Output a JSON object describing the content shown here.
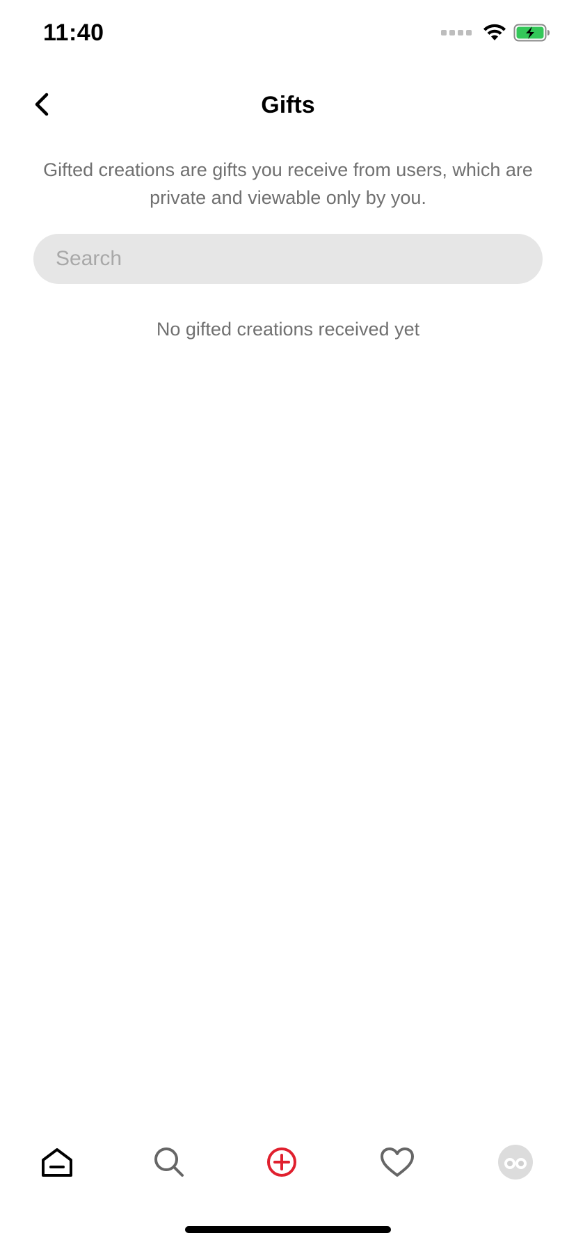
{
  "status_bar": {
    "time": "11:40",
    "icons": [
      "cellular-signal-icon",
      "wifi-icon",
      "battery-charging-icon"
    ],
    "battery_color": "#34c759"
  },
  "nav": {
    "title": "Gifts",
    "back_icon": "chevron-left-icon"
  },
  "description": "Gifted creations are gifts you receive from users, which are private and viewable only by you.",
  "search": {
    "placeholder": "Search",
    "value": ""
  },
  "empty_state": "No gifted creations received yet",
  "tab_bar": {
    "items": [
      {
        "icon": "home-icon",
        "active": true
      },
      {
        "icon": "search-icon",
        "active": false
      },
      {
        "icon": "add-circle-icon",
        "color": "#e0202e"
      },
      {
        "icon": "heart-icon",
        "active": false
      },
      {
        "icon": "profile-avatar-icon",
        "active": false
      }
    ]
  }
}
